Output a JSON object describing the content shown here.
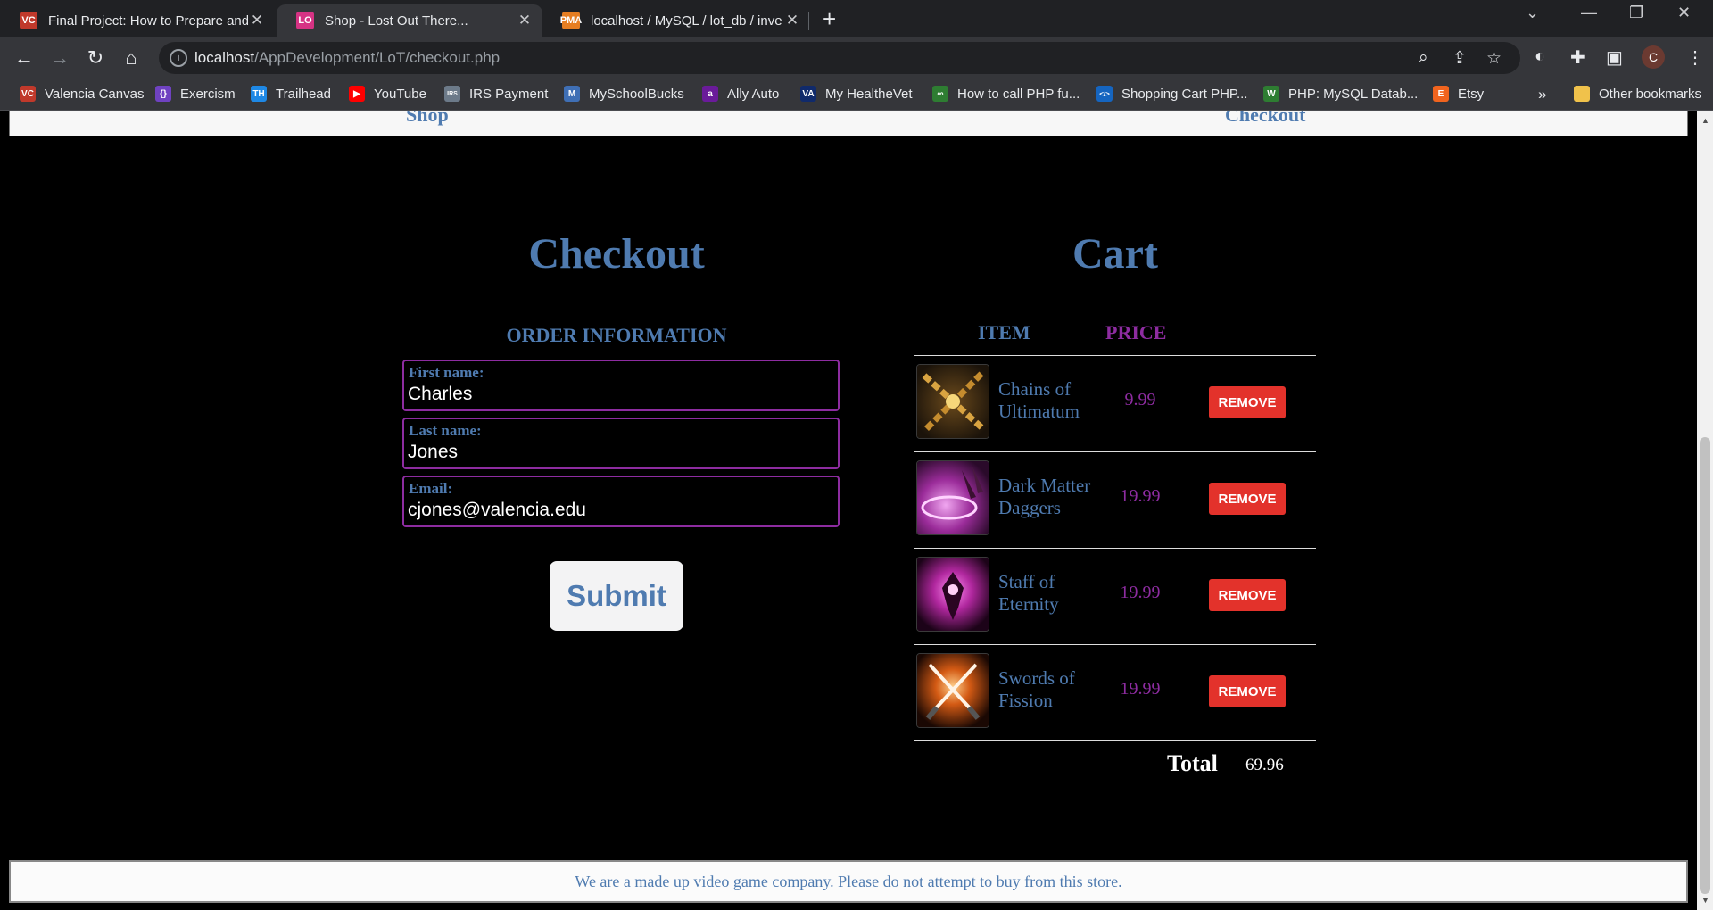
{
  "browser": {
    "tabs": [
      {
        "title": "Final Project: How to Prepare and",
        "favicon": "VC",
        "favicon_color": "#c0392b"
      },
      {
        "title": "Shop - Lost Out There...",
        "favicon": "LO",
        "favicon_color": "#d63384"
      },
      {
        "title": "localhost / MySQL / lot_db / inve",
        "favicon": "PMA",
        "favicon_color": "#e67e22"
      }
    ],
    "url_host": "localhost",
    "url_path": "/AppDevelopment/LoT/checkout.php",
    "profile_initial": "C",
    "bookmarks": [
      {
        "label": "Valencia Canvas",
        "icon": "VC",
        "color": "#c0392b"
      },
      {
        "label": "Exercism",
        "icon": "{}",
        "color": "#6f42c1"
      },
      {
        "label": "Trailhead",
        "icon": "TH",
        "color": "#1e88e5"
      },
      {
        "label": "YouTube",
        "icon": "▶",
        "color": "#ff0000"
      },
      {
        "label": "IRS Payment",
        "icon": "IRS",
        "color": "#6c7a89"
      },
      {
        "label": "MySchoolBucks",
        "icon": "M",
        "color": "#3f6fb5"
      },
      {
        "label": "Ally Auto",
        "icon": "a",
        "color": "#6a1b9a"
      },
      {
        "label": "My HealtheVet",
        "icon": "VA",
        "color": "#102a6b"
      },
      {
        "label": "How to call PHP fu...",
        "icon": "∞",
        "color": "#2e7d32"
      },
      {
        "label": "Shopping Cart PHP...",
        "icon": "</>",
        "color": "#1565c0"
      },
      {
        "label": "PHP: MySQL Datab...",
        "icon": "W",
        "color": "#2e7d32"
      },
      {
        "label": "Etsy",
        "icon": "E",
        "color": "#f1641e"
      }
    ],
    "other_bookmarks": "Other bookmarks",
    "overflow_label": "»"
  },
  "nav": {
    "shop": "Shop",
    "checkout": "Checkout"
  },
  "checkout": {
    "heading": "Checkout",
    "subheading": "ORDER INFORMATION",
    "fields": [
      {
        "label": "First name:",
        "value": "Charles"
      },
      {
        "label": "Last name:",
        "value": "Jones"
      },
      {
        "label": "Email:",
        "value": "cjones@valencia.edu"
      }
    ],
    "submit_label": "Submit"
  },
  "cart": {
    "heading": "Cart",
    "col_item": "ITEM",
    "col_price": "PRICE",
    "items": [
      {
        "name": "Chains of Ultimatum",
        "price": "9.99",
        "action": "REMOVE",
        "icon": "chains-icon"
      },
      {
        "name": "Dark Matter Daggers",
        "price": "19.99",
        "action": "REMOVE",
        "icon": "daggers-icon"
      },
      {
        "name": "Staff of Eternity",
        "price": "19.99",
        "action": "REMOVE",
        "icon": "staff-icon"
      },
      {
        "name": "Swords of Fission",
        "price": "19.99",
        "action": "REMOVE",
        "icon": "swords-icon"
      }
    ],
    "total_label": "Total",
    "total_value": "69.96"
  },
  "footer": {
    "text": "We are a made up video game company. Please do not attempt to buy from this store."
  },
  "colors": {
    "heading_blue": "#4f7bb0",
    "accent_purple": "#8d2ca0",
    "remove_red": "#e3322b",
    "page_bg": "#000000"
  }
}
